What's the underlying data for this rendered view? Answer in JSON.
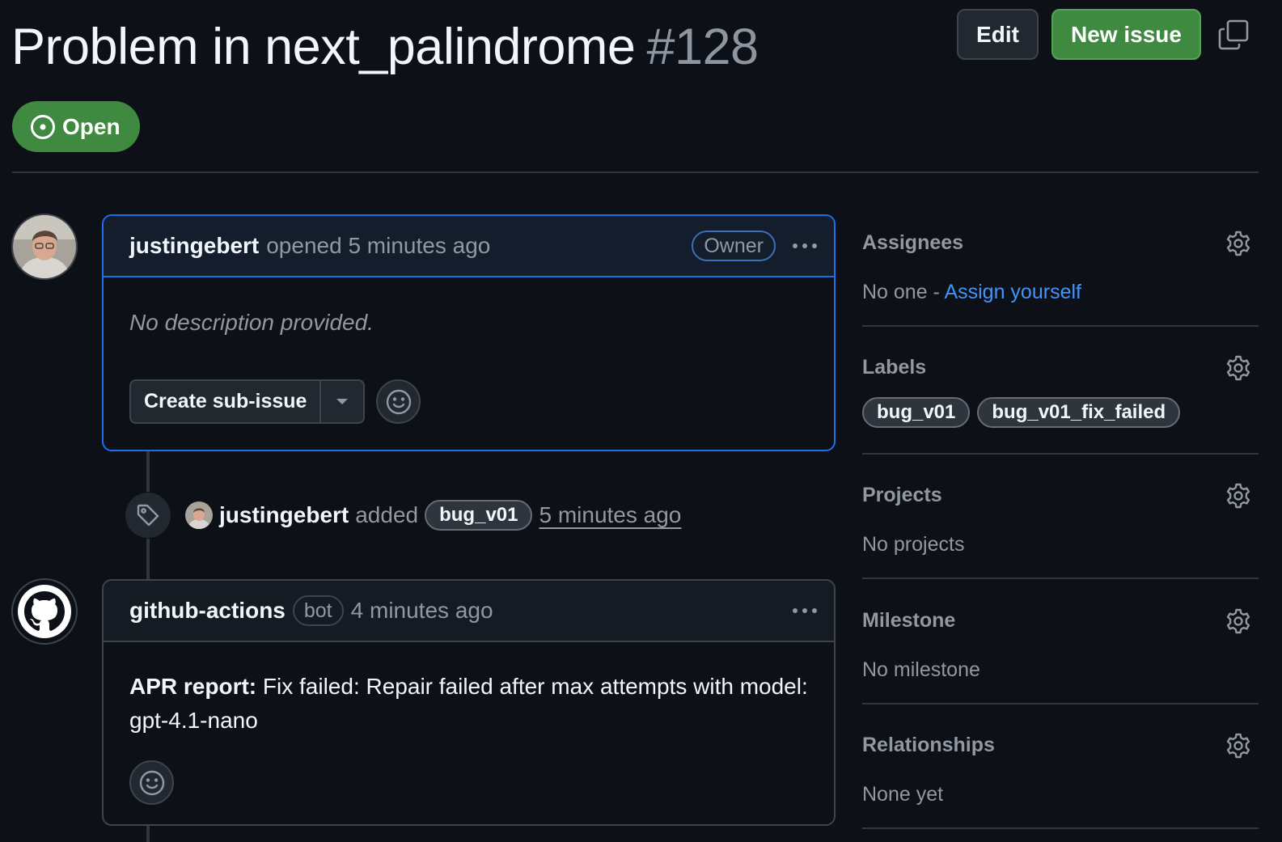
{
  "issue": {
    "title": "Problem in next_palindrome",
    "number": "#128",
    "state": "Open"
  },
  "header": {
    "edit_label": "Edit",
    "new_issue_label": "New issue"
  },
  "comments": [
    {
      "author": "justingebert",
      "action": "opened 5 minutes ago",
      "badge": "Owner",
      "body": "No description provided.",
      "sub_issue_label": "Create sub-issue"
    },
    {
      "author": "github-actions",
      "badge": "bot",
      "time": "4 minutes ago",
      "body_bold": "APR report:",
      "body_text": " Fix failed: Repair failed after max attempts with model: gpt-4.1-nano"
    }
  ],
  "event": {
    "author": "justingebert",
    "verb": "added",
    "label": "bug_v01",
    "time": "5 minutes ago"
  },
  "sidebar": {
    "assignees": {
      "title": "Assignees",
      "value": "No one - ",
      "link": "Assign yourself"
    },
    "labels": {
      "title": "Labels",
      "items": [
        "bug_v01",
        "bug_v01_fix_failed"
      ]
    },
    "projects": {
      "title": "Projects",
      "value": "No projects"
    },
    "milestone": {
      "title": "Milestone",
      "value": "No milestone"
    },
    "relationships": {
      "title": "Relationships",
      "value": "None yet"
    }
  },
  "colors": {
    "background": "#0d1117",
    "open_green": "#3f8a40",
    "accent_blue": "#1f6feb",
    "link_blue": "#4493f8"
  }
}
